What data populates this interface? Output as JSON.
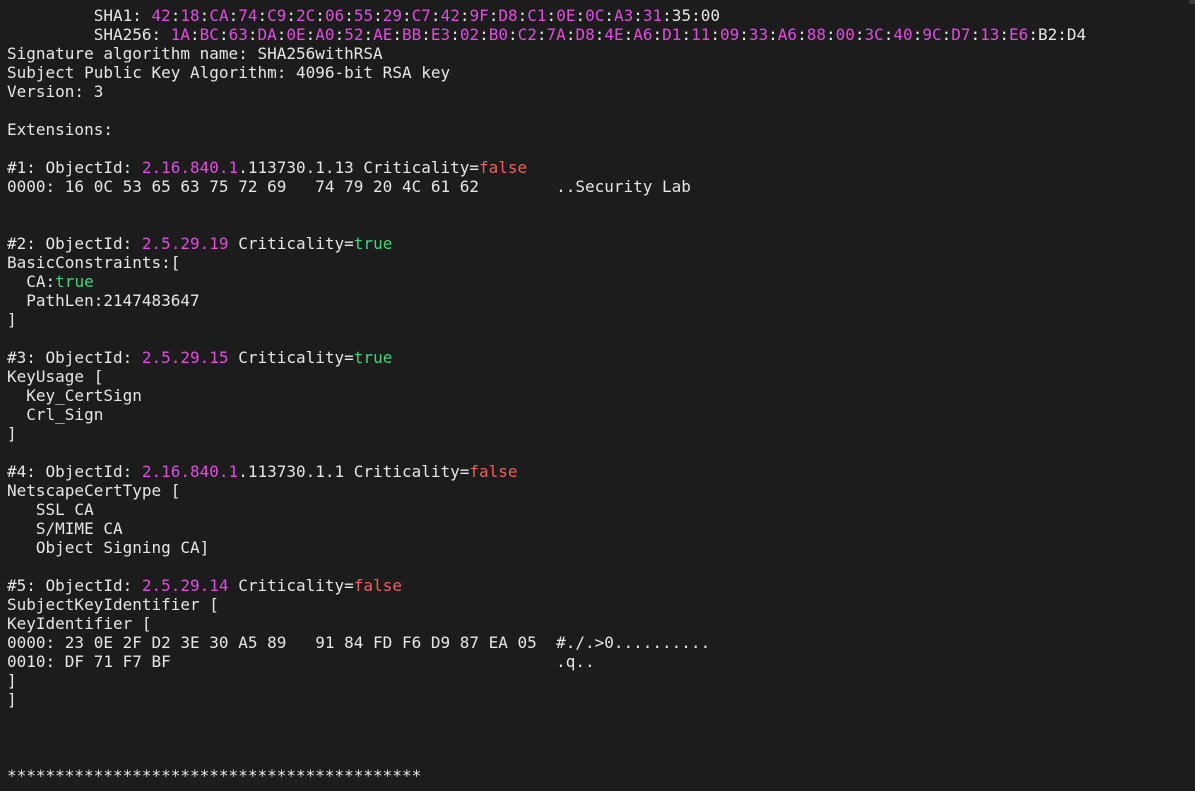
{
  "window": {
    "title": ""
  },
  "theme": {
    "background": "#1c1c1c",
    "text": "#e6e6e6",
    "magenta": "#e04ce0",
    "red": "#ee5f5f",
    "green": "#3fd67a"
  },
  "lines": [
    [
      {
        "t": "         SHA1: ",
        "c": ""
      },
      {
        "t": "42",
        "c": "m"
      },
      {
        "t": ":",
        "c": ""
      },
      {
        "t": "18",
        "c": "m"
      },
      {
        "t": ":",
        "c": ""
      },
      {
        "t": "CA",
        "c": "m"
      },
      {
        "t": ":",
        "c": ""
      },
      {
        "t": "74",
        "c": "m"
      },
      {
        "t": ":",
        "c": ""
      },
      {
        "t": "C9",
        "c": "m"
      },
      {
        "t": ":",
        "c": ""
      },
      {
        "t": "2C",
        "c": "m"
      },
      {
        "t": ":",
        "c": ""
      },
      {
        "t": "06",
        "c": "m"
      },
      {
        "t": ":",
        "c": ""
      },
      {
        "t": "55",
        "c": "m"
      },
      {
        "t": ":",
        "c": ""
      },
      {
        "t": "29",
        "c": "m"
      },
      {
        "t": ":",
        "c": ""
      },
      {
        "t": "C7",
        "c": "m"
      },
      {
        "t": ":",
        "c": ""
      },
      {
        "t": "42",
        "c": "m"
      },
      {
        "t": ":",
        "c": ""
      },
      {
        "t": "9F",
        "c": "m"
      },
      {
        "t": ":",
        "c": ""
      },
      {
        "t": "D8",
        "c": "m"
      },
      {
        "t": ":",
        "c": ""
      },
      {
        "t": "C1",
        "c": "m"
      },
      {
        "t": ":",
        "c": ""
      },
      {
        "t": "0E",
        "c": "m"
      },
      {
        "t": ":",
        "c": ""
      },
      {
        "t": "0C",
        "c": "m"
      },
      {
        "t": ":",
        "c": ""
      },
      {
        "t": "A3",
        "c": "m"
      },
      {
        "t": ":",
        "c": ""
      },
      {
        "t": "31",
        "c": "m"
      },
      {
        "t": ":35:00",
        "c": ""
      }
    ],
    [
      {
        "t": "         SHA256: ",
        "c": ""
      },
      {
        "t": "1A",
        "c": "m"
      },
      {
        "t": ":",
        "c": ""
      },
      {
        "t": "BC",
        "c": "m"
      },
      {
        "t": ":",
        "c": ""
      },
      {
        "t": "63",
        "c": "m"
      },
      {
        "t": ":",
        "c": ""
      },
      {
        "t": "DA",
        "c": "m"
      },
      {
        "t": ":",
        "c": ""
      },
      {
        "t": "0E",
        "c": "m"
      },
      {
        "t": ":",
        "c": ""
      },
      {
        "t": "A0",
        "c": "m"
      },
      {
        "t": ":",
        "c": ""
      },
      {
        "t": "52",
        "c": "m"
      },
      {
        "t": ":",
        "c": ""
      },
      {
        "t": "AE",
        "c": "m"
      },
      {
        "t": ":",
        "c": ""
      },
      {
        "t": "BB",
        "c": "m"
      },
      {
        "t": ":",
        "c": ""
      },
      {
        "t": "E3",
        "c": "m"
      },
      {
        "t": ":",
        "c": ""
      },
      {
        "t": "02",
        "c": "m"
      },
      {
        "t": ":",
        "c": ""
      },
      {
        "t": "B0",
        "c": "m"
      },
      {
        "t": ":",
        "c": ""
      },
      {
        "t": "C2",
        "c": "m"
      },
      {
        "t": ":",
        "c": ""
      },
      {
        "t": "7A",
        "c": "m"
      },
      {
        "t": ":",
        "c": ""
      },
      {
        "t": "D8",
        "c": "m"
      },
      {
        "t": ":",
        "c": ""
      },
      {
        "t": "4E",
        "c": "m"
      },
      {
        "t": ":",
        "c": ""
      },
      {
        "t": "A6",
        "c": "m"
      },
      {
        "t": ":",
        "c": ""
      },
      {
        "t": "D1",
        "c": "m"
      },
      {
        "t": ":",
        "c": ""
      },
      {
        "t": "11",
        "c": "m"
      },
      {
        "t": ":",
        "c": ""
      },
      {
        "t": "09",
        "c": "m"
      },
      {
        "t": ":",
        "c": ""
      },
      {
        "t": "33",
        "c": "m"
      },
      {
        "t": ":",
        "c": ""
      },
      {
        "t": "A6",
        "c": "m"
      },
      {
        "t": ":",
        "c": ""
      },
      {
        "t": "88",
        "c": "m"
      },
      {
        "t": ":",
        "c": ""
      },
      {
        "t": "00",
        "c": "m"
      },
      {
        "t": ":",
        "c": ""
      },
      {
        "t": "3C",
        "c": "m"
      },
      {
        "t": ":",
        "c": ""
      },
      {
        "t": "40",
        "c": "m"
      },
      {
        "t": ":",
        "c": ""
      },
      {
        "t": "9C",
        "c": "m"
      },
      {
        "t": ":",
        "c": ""
      },
      {
        "t": "D7",
        "c": "m"
      },
      {
        "t": ":",
        "c": ""
      },
      {
        "t": "13",
        "c": "m"
      },
      {
        "t": ":",
        "c": ""
      },
      {
        "t": "E6",
        "c": "m"
      },
      {
        "t": ":B2:D4",
        "c": ""
      }
    ],
    [
      {
        "t": "Signature algorithm name: SHA256withRSA",
        "c": ""
      }
    ],
    [
      {
        "t": "Subject Public Key Algorithm: 4096-bit RSA key",
        "c": ""
      }
    ],
    [
      {
        "t": "Version: 3",
        "c": ""
      }
    ],
    [
      {
        "t": "",
        "c": ""
      }
    ],
    [
      {
        "t": "Extensions:",
        "c": ""
      }
    ],
    [
      {
        "t": "",
        "c": ""
      }
    ],
    [
      {
        "t": "#1: ObjectId: ",
        "c": ""
      },
      {
        "t": "2.16.840.1",
        "c": "m"
      },
      {
        "t": ".113730.1.13 Criticality=",
        "c": ""
      },
      {
        "t": "false",
        "c": "r"
      }
    ],
    [
      {
        "t": "0000: 16 0C 53 65 63 75 72 69   74 79 20 4C 61 62        ..Security Lab",
        "c": ""
      }
    ],
    [
      {
        "t": "",
        "c": ""
      }
    ],
    [
      {
        "t": "",
        "c": ""
      }
    ],
    [
      {
        "t": "#2: ObjectId: ",
        "c": ""
      },
      {
        "t": "2.5.29.19",
        "c": "m"
      },
      {
        "t": " Criticality=",
        "c": ""
      },
      {
        "t": "true",
        "c": "g"
      }
    ],
    [
      {
        "t": "BasicConstraints:[",
        "c": ""
      }
    ],
    [
      {
        "t": "  CA:",
        "c": ""
      },
      {
        "t": "true",
        "c": "g"
      }
    ],
    [
      {
        "t": "  PathLen:2147483647",
        "c": ""
      }
    ],
    [
      {
        "t": "]",
        "c": ""
      }
    ],
    [
      {
        "t": "",
        "c": ""
      }
    ],
    [
      {
        "t": "#3: ObjectId: ",
        "c": ""
      },
      {
        "t": "2.5.29.15",
        "c": "m"
      },
      {
        "t": " Criticality=",
        "c": ""
      },
      {
        "t": "true",
        "c": "g"
      }
    ],
    [
      {
        "t": "KeyUsage [",
        "c": ""
      }
    ],
    [
      {
        "t": "  Key_CertSign",
        "c": ""
      }
    ],
    [
      {
        "t": "  Crl_Sign",
        "c": ""
      }
    ],
    [
      {
        "t": "]",
        "c": ""
      }
    ],
    [
      {
        "t": "",
        "c": ""
      }
    ],
    [
      {
        "t": "#4: ObjectId: ",
        "c": ""
      },
      {
        "t": "2.16.840.1",
        "c": "m"
      },
      {
        "t": ".113730.1.1 Criticality=",
        "c": ""
      },
      {
        "t": "false",
        "c": "r"
      }
    ],
    [
      {
        "t": "NetscapeCertType [",
        "c": ""
      }
    ],
    [
      {
        "t": "   SSL CA",
        "c": ""
      }
    ],
    [
      {
        "t": "   S/MIME CA",
        "c": ""
      }
    ],
    [
      {
        "t": "   Object Signing CA]",
        "c": ""
      }
    ],
    [
      {
        "t": "",
        "c": ""
      }
    ],
    [
      {
        "t": "#5: ObjectId: ",
        "c": ""
      },
      {
        "t": "2.5.29.14",
        "c": "m"
      },
      {
        "t": " Criticality=",
        "c": ""
      },
      {
        "t": "false",
        "c": "r"
      }
    ],
    [
      {
        "t": "SubjectKeyIdentifier [",
        "c": ""
      }
    ],
    [
      {
        "t": "KeyIdentifier [",
        "c": ""
      }
    ],
    [
      {
        "t": "0000: 23 0E 2F D2 3E 30 A5 89   91 84 FD F6 D9 87 EA 05  #./.>0..........",
        "c": ""
      }
    ],
    [
      {
        "t": "0010: DF 71 F7 BF                                        .q..",
        "c": ""
      }
    ],
    [
      {
        "t": "]",
        "c": ""
      }
    ],
    [
      {
        "t": "]",
        "c": ""
      }
    ],
    [
      {
        "t": "",
        "c": ""
      }
    ],
    [
      {
        "t": "",
        "c": ""
      }
    ],
    [
      {
        "t": "",
        "c": ""
      }
    ],
    [
      {
        "t": "*******************************************",
        "c": ""
      }
    ]
  ]
}
